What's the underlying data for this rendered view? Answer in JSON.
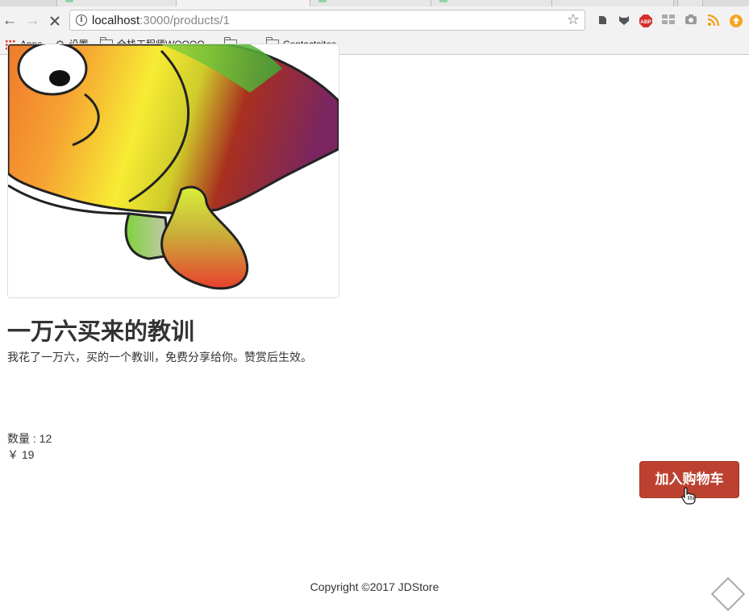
{
  "browser": {
    "url_host": "localhost",
    "url_path": ":3000/products/1",
    "bookmarks": [
      "Apps",
      "设置",
      "全栈工程师WOOOO...",
      "......",
      "Contactsites"
    ]
  },
  "product": {
    "title": "一万六买来的教训",
    "description": "我花了一万六，买的一个教训，免费分享给你。赞赏后生效。",
    "quantity": "数量 : 12",
    "price": "￥ 19",
    "add_to_cart_label": "加入购物车"
  },
  "footer": {
    "copyright": "Copyright ©2017 JDStore"
  },
  "colors": {
    "cart_button": "#bd4130"
  }
}
